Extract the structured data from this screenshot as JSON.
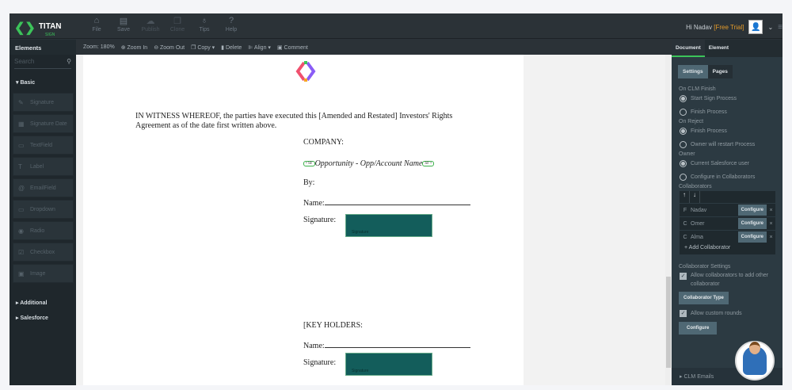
{
  "header": {
    "logo_title": "TITAN",
    "logo_sub": "SIGN",
    "tools": [
      {
        "label": "File",
        "icon": "file-icon"
      },
      {
        "label": "Save",
        "icon": "save-icon"
      },
      {
        "label": "Publish",
        "icon": "cloud-upload-icon"
      },
      {
        "label": "Clone",
        "icon": "clone-icon"
      },
      {
        "label": "Tips",
        "icon": "lightbulb-icon"
      },
      {
        "label": "Help",
        "icon": "help-icon"
      }
    ],
    "greeting": "Hi Nadav",
    "trial": "[Free Trial]"
  },
  "toolbar": {
    "zoom": "Zoom: 180%",
    "zoom_in": "Zoom In",
    "zoom_out": "Zoom Out",
    "copy": "Copy",
    "delete": "Delete",
    "align": "Align",
    "comment": "Comment"
  },
  "sidebar": {
    "title": "Elements",
    "search_placeholder": "Search",
    "basic": "Basic",
    "items": [
      "Signature",
      "Signature Date",
      "TextField",
      "Label",
      "EmailField",
      "Dropdown",
      "Radio",
      "Checkbox",
      "Image"
    ],
    "additional": "Additional",
    "salesforce": "Salesforce"
  },
  "document": {
    "witness": "IN WITNESS WHEREOF, the parties have executed this [Amended and Restated] Investors' Rights Agreement as of the date first written above.",
    "company": "COMPANY:",
    "sf_tag": "SF",
    "sf_field": "Opportunity - Opp/Account Name",
    "by": "By:",
    "name": "Name:",
    "signature": "Signature:",
    "sig_field": "Signature",
    "key_holders": "[KEY HOLDERS:"
  },
  "right": {
    "tabs": [
      "Document",
      "Element"
    ],
    "subtabs": [
      "Settings",
      "Pages"
    ],
    "on_finish": "On CLM Finish",
    "finish_opts": [
      "Start Sign Process",
      "Finish Process"
    ],
    "on_reject": "On Reject",
    "reject_opts": [
      "Finish Process",
      "Owner will restart Process"
    ],
    "owner": "Owner",
    "owner_opts": [
      "Current Salesforce user",
      "Configure in Collaborators"
    ],
    "collaborators": "Collaborators",
    "collab_list": [
      {
        "type": "F",
        "name": "Nadav"
      },
      {
        "type": "C",
        "name": "Omer"
      },
      {
        "type": "C",
        "name": "Alma"
      }
    ],
    "configure": "Configure",
    "add_collab": "Add Collaborator",
    "collab_settings": "Collaborator Settings",
    "allow_add": "Allow collaborators to add other collaborator",
    "collab_type": "Collaborator Type",
    "allow_rounds": "Allow custom rounds",
    "clm_emails": "CLM Emails"
  }
}
